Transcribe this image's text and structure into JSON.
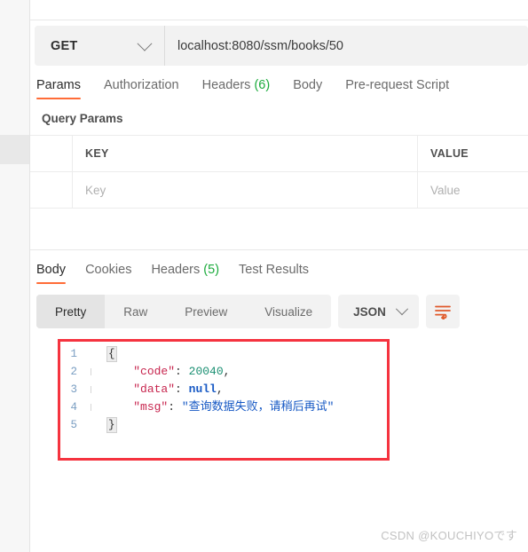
{
  "request": {
    "method": "GET",
    "url": "localhost:8080/ssm/books/50",
    "tabs": [
      {
        "label": "Params",
        "count": "",
        "active": true
      },
      {
        "label": "Authorization",
        "count": "",
        "active": false
      },
      {
        "label": "Headers",
        "count": "(6)",
        "active": false
      },
      {
        "label": "Body",
        "count": "",
        "active": false
      },
      {
        "label": "Pre-request Script",
        "count": "",
        "active": false
      }
    ],
    "query_params": {
      "title": "Query Params",
      "columns": [
        "KEY",
        "VALUE"
      ],
      "rows": [
        {
          "key_placeholder": "Key",
          "value_placeholder": "Value"
        }
      ]
    }
  },
  "response": {
    "tabs": [
      {
        "label": "Body",
        "count": "",
        "active": true
      },
      {
        "label": "Cookies",
        "count": "",
        "active": false
      },
      {
        "label": "Headers",
        "count": "(5)",
        "active": false
      },
      {
        "label": "Test Results",
        "count": "",
        "active": false
      }
    ],
    "view_modes": [
      {
        "label": "Pretty",
        "active": true
      },
      {
        "label": "Raw",
        "active": false
      },
      {
        "label": "Preview",
        "active": false
      },
      {
        "label": "Visualize",
        "active": false
      }
    ],
    "format": "JSON",
    "wrap_icon": "wrap-lines-icon",
    "body_lines": [
      {
        "num": "1",
        "brace": "{",
        "text": ""
      },
      {
        "num": "2",
        "brace": "",
        "text": "    \"code\": 20040,"
      },
      {
        "num": "3",
        "brace": "",
        "text": "    \"data\": null,"
      },
      {
        "num": "4",
        "brace": "",
        "text": "    \"msg\": \"查询数据失败，请稍后再试\""
      },
      {
        "num": "5",
        "brace": "}",
        "text": ""
      }
    ],
    "body_json": {
      "code": 20040,
      "data": null,
      "msg": "查询数据失败，请稍后再试"
    }
  },
  "annotation": {
    "highlight_color": "#f5333f"
  },
  "watermark": "CSDN @KOUCHIYOです",
  "colors": {
    "accent": "#ff6c37",
    "count_green": "#1bab3c",
    "json_key": "#c7254e",
    "json_number": "#1a8f72",
    "json_null": "#1658c4",
    "json_string": "#1658c4"
  }
}
